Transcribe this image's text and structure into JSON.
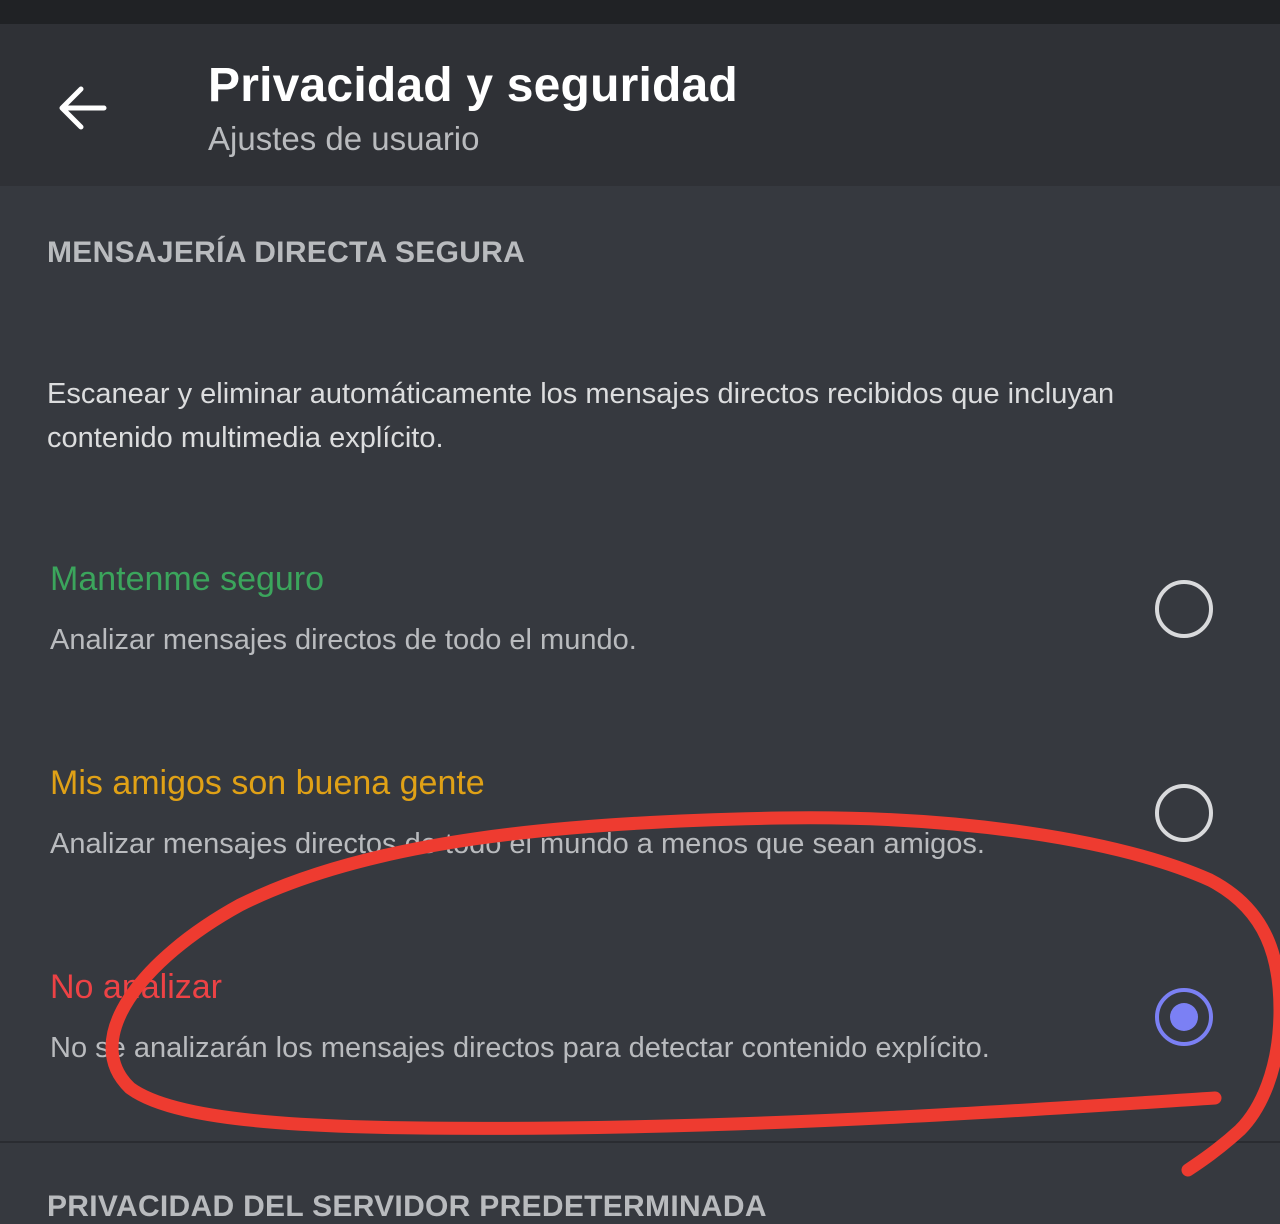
{
  "header": {
    "title": "Privacidad y seguridad",
    "subtitle": "Ajustes de usuario",
    "back_icon": "arrow-left-icon"
  },
  "section_dm": {
    "heading": "MENSAJERÍA DIRECTA SEGURA",
    "description": "Escanear y eliminar automáticamente los mensajes directos recibidos que incluyan contenido multimedia explícito.",
    "options": [
      {
        "title": "Mantenme seguro",
        "subtitle": "Analizar mensajes directos de todo el mundo.",
        "color": "#3ba55c",
        "selected": false
      },
      {
        "title": "Mis amigos son buena gente",
        "subtitle": "Analizar mensajes directos de todo el mundo a menos que sean amigos.",
        "color": "#e0a116",
        "selected": false
      },
      {
        "title": "No analizar",
        "subtitle": "No se analizarán los mensajes directos para detectar contenido explícito.",
        "color": "#ed4245",
        "selected": true
      }
    ]
  },
  "section_server": {
    "heading": "PRIVACIDAD DEL SERVIDOR PREDETERMINADA"
  },
  "colors": {
    "background": "#36393f",
    "header_bg": "#2f3136",
    "radio_accent": "#7b80f4",
    "annotation": "#ee3b30"
  }
}
